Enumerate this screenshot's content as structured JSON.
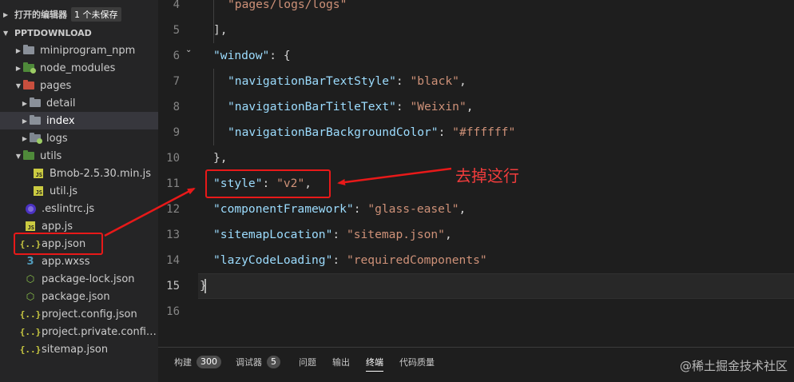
{
  "sidebar": {
    "open_editors": {
      "title": "打开的编辑器",
      "badge": "1 个未保存"
    },
    "project": {
      "title": "PPTDOWNLOAD"
    },
    "items": [
      {
        "label": "miniprogram_npm",
        "icon": "folder-icon"
      },
      {
        "label": "node_modules",
        "icon": "node-folder-icon"
      },
      {
        "label": "pages",
        "icon": "pages-folder-icon"
      },
      {
        "label": "detail",
        "icon": "folder-icon"
      },
      {
        "label": "index",
        "icon": "folder-icon"
      },
      {
        "label": "logs",
        "icon": "logs-folder-icon"
      },
      {
        "label": "utils",
        "icon": "utils-folder-icon"
      },
      {
        "label": "Bmob-2.5.30.min.js",
        "icon": "js-file-icon"
      },
      {
        "label": "util.js",
        "icon": "js-file-icon"
      },
      {
        "label": ".eslintrc.js",
        "icon": "eslint-icon"
      },
      {
        "label": "app.js",
        "icon": "js-file-icon"
      },
      {
        "label": "app.json",
        "icon": "json-file-icon"
      },
      {
        "label": "app.wxss",
        "icon": "css-file-icon"
      },
      {
        "label": "package-lock.json",
        "icon": "package-icon"
      },
      {
        "label": "package.json",
        "icon": "package-icon"
      },
      {
        "label": "project.config.json",
        "icon": "json-file-icon"
      },
      {
        "label": "project.private.config.js...",
        "icon": "json-file-icon"
      },
      {
        "label": "sitemap.json",
        "icon": "json-file-icon"
      }
    ]
  },
  "editor": {
    "lines": [
      {
        "n": "4",
        "tokens": [
          [
            "str",
            "\"pages/logs/logs\""
          ]
        ]
      },
      {
        "n": "5",
        "tokens": [
          [
            "pun",
            "],"
          ]
        ]
      },
      {
        "n": "6",
        "tokens": [
          [
            "key",
            "\"window\""
          ],
          [
            "pun",
            ": {"
          ]
        ]
      },
      {
        "n": "7",
        "tokens": [
          [
            "key",
            "\"navigationBarTextStyle\""
          ],
          [
            "pun",
            ": "
          ],
          [
            "str",
            "\"black\""
          ],
          [
            "pun",
            ","
          ]
        ]
      },
      {
        "n": "8",
        "tokens": [
          [
            "key",
            "\"navigationBarTitleText\""
          ],
          [
            "pun",
            ": "
          ],
          [
            "str",
            "\"Weixin\""
          ],
          [
            "pun",
            ","
          ]
        ]
      },
      {
        "n": "9",
        "tokens": [
          [
            "key",
            "\"navigationBarBackgroundColor\""
          ],
          [
            "pun",
            ": "
          ],
          [
            "str",
            "\"#ffffff\""
          ]
        ]
      },
      {
        "n": "10",
        "tokens": [
          [
            "pun",
            "},"
          ]
        ]
      },
      {
        "n": "11",
        "tokens": [
          [
            "key",
            "\"style\""
          ],
          [
            "pun",
            ": "
          ],
          [
            "str",
            "\"v2\""
          ],
          [
            "pun",
            ","
          ]
        ]
      },
      {
        "n": "12",
        "tokens": [
          [
            "key",
            "\"componentFramework\""
          ],
          [
            "pun",
            ": "
          ],
          [
            "str",
            "\"glass-easel\""
          ],
          [
            "pun",
            ","
          ]
        ]
      },
      {
        "n": "13",
        "tokens": [
          [
            "key",
            "\"sitemapLocation\""
          ],
          [
            "pun",
            ": "
          ],
          [
            "str",
            "\"sitemap.json\""
          ],
          [
            "pun",
            ","
          ]
        ]
      },
      {
        "n": "14",
        "tokens": [
          [
            "key",
            "\"lazyCodeLoading\""
          ],
          [
            "pun",
            ": "
          ],
          [
            "str",
            "\"requiredComponents\""
          ]
        ]
      },
      {
        "n": "15",
        "tokens": [
          [
            "pun",
            "}"
          ]
        ]
      },
      {
        "n": "16",
        "tokens": []
      }
    ],
    "annotation": "去掉这行"
  },
  "panel": {
    "tabs": [
      {
        "label": "构建",
        "count": "300"
      },
      {
        "label": "调试器",
        "count": "5"
      },
      {
        "label": "问题",
        "count": ""
      },
      {
        "label": "输出",
        "count": ""
      },
      {
        "label": "终端",
        "count": ""
      },
      {
        "label": "代码质量",
        "count": ""
      }
    ],
    "active_tab": "终端",
    "watermark": "@稀土掘金技术社区"
  },
  "colors": {
    "annotation_red": "#e81919",
    "json_key": "#9cdcfe",
    "json_string": "#ce9178"
  }
}
